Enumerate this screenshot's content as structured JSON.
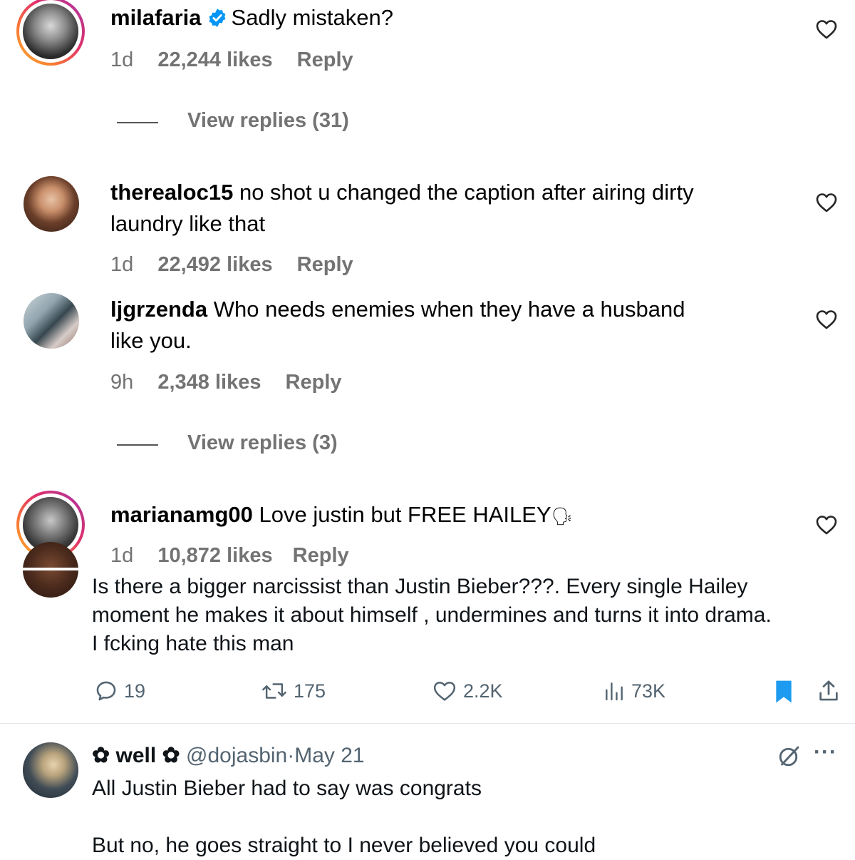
{
  "comments": [
    {
      "username": "milafaria",
      "verified": true,
      "text": "Sadly mistaken?",
      "time": "1d",
      "likes": "22,244 likes",
      "reply": "Reply",
      "view_replies": "View replies (31)"
    },
    {
      "username": "therealoc15",
      "text_line1": "no shot u changed the caption after airing dirty",
      "text_line2": "laundry like that",
      "time": "1d",
      "likes": "22,492 likes",
      "reply": "Reply"
    },
    {
      "username": "ljgrzenda",
      "text_line1": "Who needs enemies when they have a husband",
      "text_line2": "like you.",
      "time": "9h",
      "likes": "2,348 likes",
      "reply": "Reply",
      "view_replies": "View replies (3)"
    },
    {
      "username": "marianamg00",
      "text": "Love justin but FREE HAILEY",
      "emoji": "🗣",
      "time": "1d",
      "likes": "10,872 likes",
      "reply": "Reply"
    }
  ],
  "tweet1": {
    "text_line1": "Is there a bigger narcissist than Justin Bieber???. Every single Hailey",
    "text_line2": "moment he makes it about himself , undermines and turns it into drama.",
    "text_line3": "I fcking hate this man",
    "replies": "19",
    "retweets": "175",
    "likes": "2.2K",
    "views": "73K"
  },
  "tweet2": {
    "display_name": "well",
    "handle": "@dojasbin",
    "separator": "·",
    "date": "May 21",
    "more": "···",
    "text_line1": "All Justin Bieber had to say was congrats",
    "text_line2": "But no, he goes straight to I never believed you could"
  },
  "colors": {
    "meta_gray": "#737373",
    "twitter_gray": "#536471",
    "bookmark_blue": "#1d9bf0",
    "verified_blue": "#0095f6"
  }
}
